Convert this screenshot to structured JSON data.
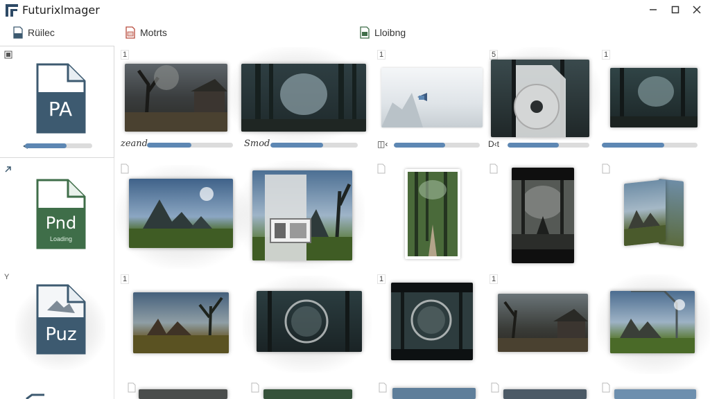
{
  "window": {
    "title": "Futurixlmager",
    "controls": [
      "minimize",
      "maximize",
      "close"
    ],
    "accent": "#2e4a66"
  },
  "toolbar": {
    "items": [
      {
        "label": "Rüilec",
        "icon": "document-icon"
      },
      {
        "label": "Motrts",
        "icon": "image-file-icon"
      },
      {
        "label": "Lloibng",
        "icon": "green-file-icon"
      }
    ]
  },
  "sidebar": {
    "items": [
      {
        "badge": "PA",
        "color": "#3d5a70",
        "progress": 0.62
      },
      {
        "badge": "Pnd",
        "sublabel": "Loading",
        "color": "#3f6e49"
      },
      {
        "badge": "Puz",
        "color": "#3d5a70",
        "marker": "Y"
      }
    ]
  },
  "grid": {
    "row1": [
      {
        "num": "1",
        "caption": "zeand",
        "progress": 0.52,
        "scene": "Dusk hut"
      },
      {
        "num": "",
        "caption": "Smod",
        "progress": 0.6,
        "scene": "Forest window"
      },
      {
        "num": "1",
        "caption": "◫‹",
        "progress": 0.6,
        "scene": "Sky play"
      },
      {
        "num": "5",
        "caption": "D‹t",
        "progress": 0.63,
        "scene": "Disc overlay"
      },
      {
        "num": "1",
        "caption": "",
        "progress": 0.65,
        "scene": "Dark forest"
      }
    ],
    "row3_nums": [
      "1",
      "",
      "1",
      "1",
      ""
    ]
  }
}
